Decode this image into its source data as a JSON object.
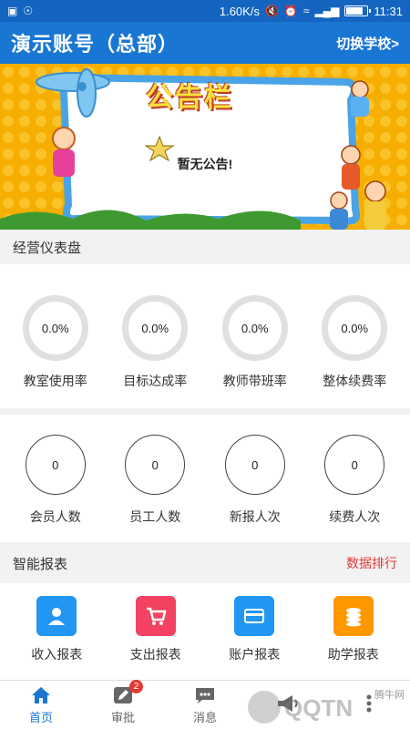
{
  "status_bar": {
    "speed": "1.60K/s",
    "time": "11:31",
    "battery_level": 0.9
  },
  "header": {
    "title": "演示账号（总部）",
    "switch_label": "切换学校>"
  },
  "banner": {
    "banner_title": "公告栏",
    "notice": "暂无公告!"
  },
  "dashboard": {
    "title": "经营仪表盘",
    "rates": [
      {
        "label": "教室使用率",
        "value": "0.0%"
      },
      {
        "label": "目标达成率",
        "value": "0.0%"
      },
      {
        "label": "教师带班率",
        "value": "0.0%"
      },
      {
        "label": "整体续费率",
        "value": "0.0%"
      }
    ],
    "counts": [
      {
        "label": "会员人数",
        "value": "0"
      },
      {
        "label": "员工人数",
        "value": "0"
      },
      {
        "label": "新报人次",
        "value": "0"
      },
      {
        "label": "续费人次",
        "value": "0"
      }
    ]
  },
  "reports": {
    "title": "智能报表",
    "ranking_link": "数据排行",
    "items": [
      {
        "label": "收入报表",
        "icon": "user-icon",
        "color": "#2196f3"
      },
      {
        "label": "支出报表",
        "icon": "cart-icon",
        "color": "#f44362"
      },
      {
        "label": "账户报表",
        "icon": "card-icon",
        "color": "#2196f3"
      },
      {
        "label": "助学报表",
        "icon": "coins-icon",
        "color": "#ff9800"
      }
    ]
  },
  "tabbar": {
    "tabs": [
      {
        "label": "首页",
        "icon": "home-icon",
        "active": true
      },
      {
        "label": "审批",
        "icon": "pencil-icon",
        "badge": "2"
      },
      {
        "label": "消息",
        "icon": "chat-icon"
      },
      {
        "label": "",
        "icon": "megaphone-icon"
      },
      {
        "label": "",
        "icon": "more-icon"
      }
    ]
  },
  "watermark": {
    "brand": "QQTN",
    "site": "腾牛网"
  },
  "colors": {
    "primary": "#1976d2",
    "accent_red": "#e53935",
    "banner_yellow": "#f7b500"
  }
}
